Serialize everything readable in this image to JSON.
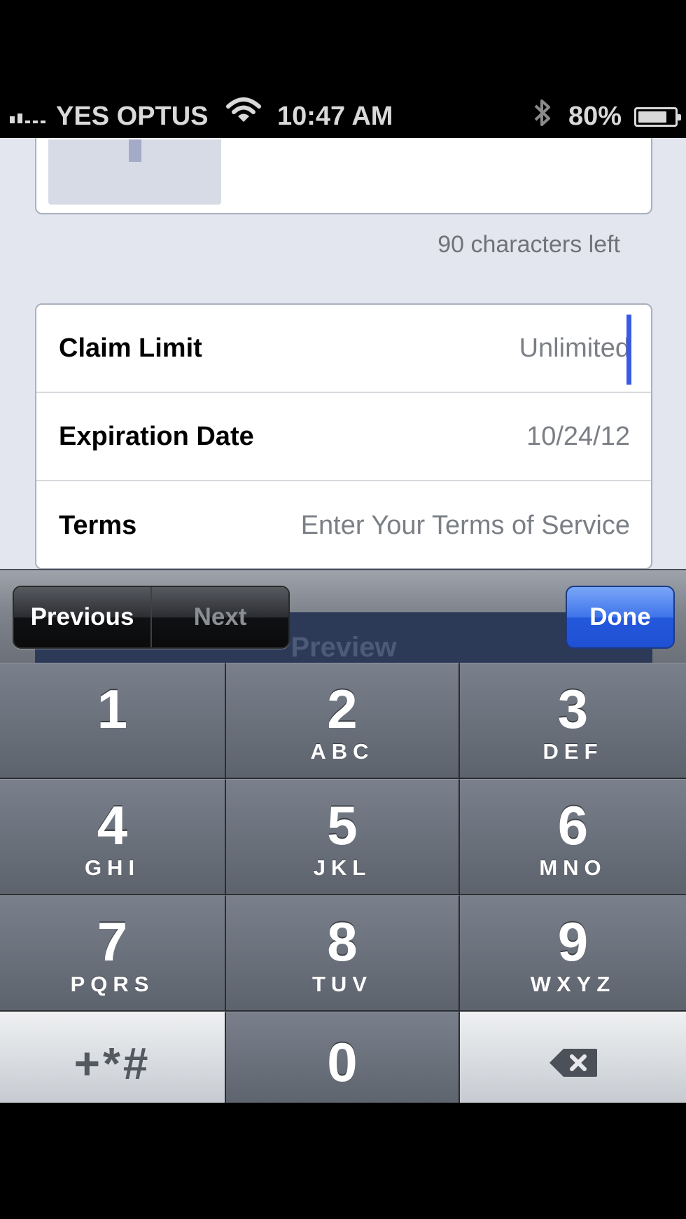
{
  "status_bar": {
    "carrier": "YES OPTUS",
    "time": "10:47 AM",
    "battery": "80%",
    "battery_level": 0.8,
    "icons": [
      "signal-icon",
      "wifi-icon",
      "bluetooth-icon",
      "battery-icon"
    ]
  },
  "form": {
    "char_count": "90 characters left",
    "rows": [
      {
        "label": "Claim Limit",
        "value": "Unlimited"
      },
      {
        "label": "Expiration Date",
        "value": "10/24/12"
      },
      {
        "label": "Terms",
        "value": "Enter Your Terms of Service"
      }
    ],
    "behind_button": "Preview"
  },
  "toolbar": {
    "previous": "Previous",
    "next": "Next",
    "done": "Done"
  },
  "keypad": {
    "keys": [
      {
        "digit": "1",
        "letters": ""
      },
      {
        "digit": "2",
        "letters": "ABC"
      },
      {
        "digit": "3",
        "letters": "DEF"
      },
      {
        "digit": "4",
        "letters": "GHI"
      },
      {
        "digit": "5",
        "letters": "JKL"
      },
      {
        "digit": "6",
        "letters": "MNO"
      },
      {
        "digit": "7",
        "letters": "PQRS"
      },
      {
        "digit": "8",
        "letters": "TUV"
      },
      {
        "digit": "9",
        "letters": "WXYZ"
      }
    ],
    "symbols": "+*#",
    "zero": "0",
    "backspace_icon": "backspace-icon"
  },
  "colors": {
    "accent": "#2458db",
    "cursor": "#3a59e4"
  }
}
